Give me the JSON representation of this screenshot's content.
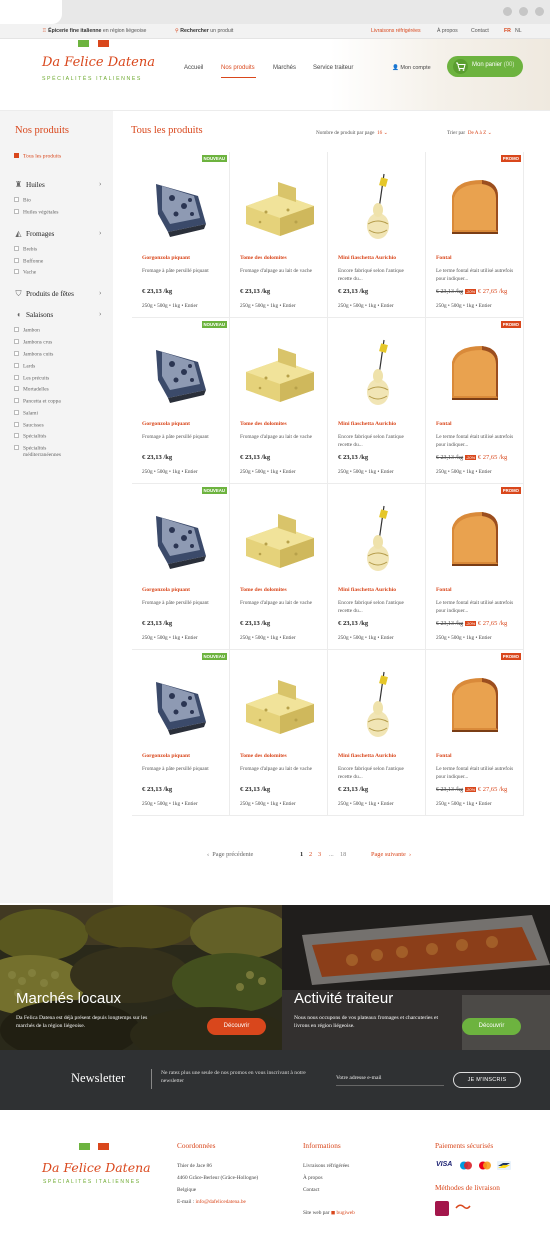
{
  "topbar": {
    "tagline_bold": "Épicerie fine italienne",
    "tagline_rest": " en région liégeoise",
    "search_bold": "Rechercher",
    "search_rest": " un produit",
    "delivery": "Livraisons réfrigérées",
    "about": "À propos",
    "contact": "Contact",
    "lang_fr": "FR",
    "lang_nl": "NL"
  },
  "brand": {
    "name": "Da Felice Datena",
    "subtitle": "SPÉCIALITÉS ITALIENNES",
    "green": "#6db33f",
    "red": "#d9471c"
  },
  "nav": {
    "items": [
      "Accueil",
      "Nos produits",
      "Marchés",
      "Service traiteur"
    ],
    "account": "Mon compte",
    "cart_label": "Mon panier",
    "cart_count": "(00)"
  },
  "sidebar": {
    "title": "Nos produits",
    "all": "Tous les produits",
    "categories": [
      {
        "label": "Huiles",
        "icon": "bottle-icon",
        "items": [
          "Bio",
          "Huiles végétales"
        ]
      },
      {
        "label": "Fromages",
        "icon": "cheese-icon",
        "items": [
          "Brebis",
          "Buffonne",
          "Vache"
        ]
      },
      {
        "label": "Produits de fêtes",
        "icon": "gift-icon",
        "items": []
      },
      {
        "label": "Salaisons",
        "icon": "sausage-icon",
        "items": [
          "Jambon",
          "Jambons crus",
          "Jambons cuits",
          "Lards",
          "Les précuits",
          "Mortadelles",
          "Pancetta et coppa",
          "Salami",
          "Saucisses",
          "Spécialités",
          "Spécialités",
          "méditerranéennes"
        ]
      }
    ]
  },
  "main": {
    "title": "Tous les produits",
    "perpage_label": "Nombre de produit par page",
    "perpage_value": "16",
    "sort_label": "Trier par",
    "sort_value": "De A à Z"
  },
  "products": [
    {
      "name": "Gorgonzola piquant",
      "desc": "Fromage à pâte persillé piquant",
      "price": "€ 23,13 /kg",
      "weights": "250g  •  500g  •  1kg  •  Entier",
      "badge": "NOUVEAU",
      "kind": "gorgonzola"
    },
    {
      "name": "Tome des dolomites",
      "desc": "Fromage d'alpage au lait de vache",
      "price": "€ 23,13 /kg",
      "weights": "250g  •  500g  •  1kg  •  Entier",
      "badge": "",
      "kind": "tome"
    },
    {
      "name": "Mini fiaschetta Aurichio",
      "desc": "Encore fabriqué selon l'antique recette du...",
      "price": "€ 23,13 /kg",
      "weights": "250g  •  500g  •  1kg  •  Entier",
      "badge": "",
      "kind": "fiaschetta"
    },
    {
      "name": "Fontal",
      "desc": "Le terme fontal était utilisé autrefois pour indiquer...",
      "old_price": "€ 23,13 /kg",
      "discount": "-20%",
      "new_price": "€ 27,65 /kg",
      "weights": "250g  •  500g  •  1kg  •  Entier",
      "badge": "PROMO",
      "kind": "fontal"
    }
  ],
  "pagination": {
    "prev": "Page précédente",
    "pages": [
      "1",
      "2",
      "3",
      "...",
      "18"
    ],
    "next": "Page suivante"
  },
  "banners": {
    "left": {
      "title": "Marchés locaux",
      "text": "Da Felica Datena est déjà présent depuis longtemps sur les marchés de la région liégeoise.",
      "button": "Découvrir"
    },
    "right": {
      "title": "Activité traiteur",
      "text": "Nous nous occupons de vos plateaux fromages et charcuteries et livrons en région liégeoise.",
      "button": "Découvrir"
    }
  },
  "newsletter": {
    "title": "Newsletter",
    "text": "Ne ratez plus une seule de nos promos en vous inscrivant à notre newsletter",
    "placeholder": "Votre adresse e-mail",
    "button": "JE M'INSCRIS"
  },
  "footer": {
    "coords_title": "Coordonnées",
    "address1": "Thier de Jace 86",
    "address2": "4460 Grâce-Berleur (Grâce-Hollogne)",
    "address3": "Belgique",
    "email_label": "E-mail : ",
    "email": "info@dafelicedatena.be",
    "info_title": "Informations",
    "info_links": [
      "Livraisons réfrigérées",
      "À propos",
      "Contact"
    ],
    "site_by": "Site web par",
    "agency": "bugiweb",
    "pay_title": "Paiements sécurisés",
    "payments": [
      "VISA",
      "Maestro",
      "MasterCard",
      "Bancontact"
    ],
    "delivery_title": "Méthodes de livraison"
  }
}
